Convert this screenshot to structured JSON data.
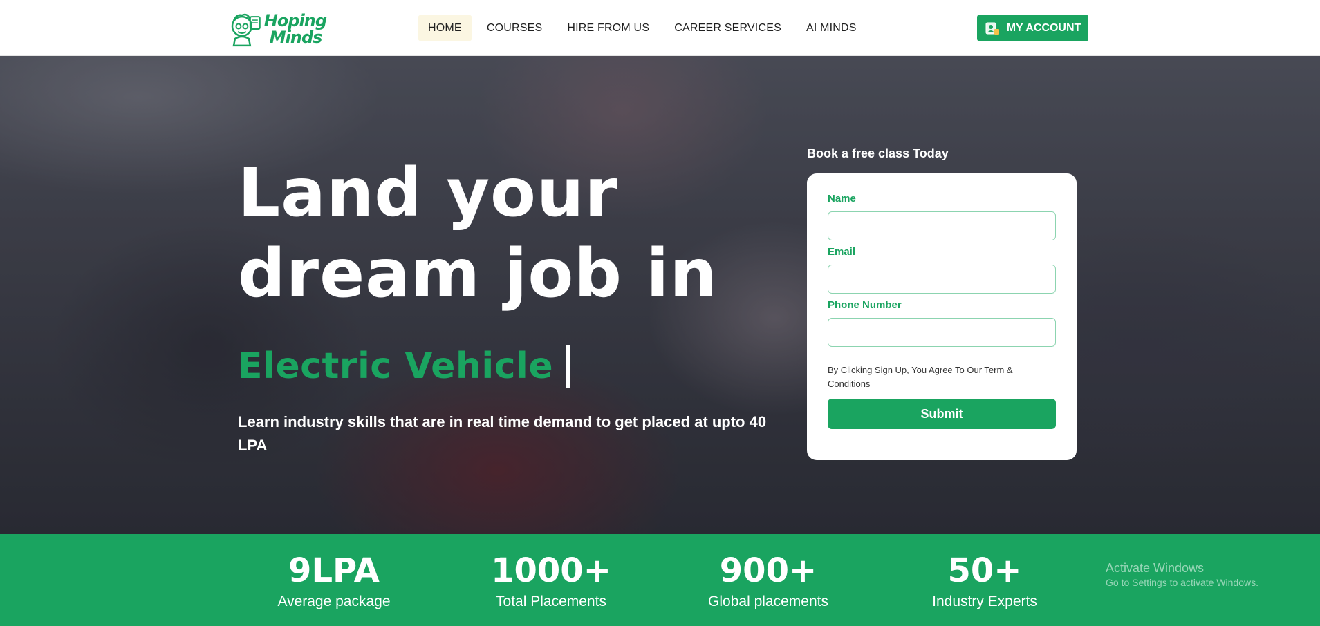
{
  "brand": {
    "line1": "Hoping",
    "line2": "Minds"
  },
  "nav": {
    "items": [
      {
        "label": "HOME",
        "active": true
      },
      {
        "label": "COURSES",
        "active": false
      },
      {
        "label": "HIRE FROM US",
        "active": false
      },
      {
        "label": "CAREER SERVICES",
        "active": false
      },
      {
        "label": "AI MINDS",
        "active": false
      }
    ],
    "account_label": "MY ACCOUNT"
  },
  "hero": {
    "headline_line1": "Land your",
    "headline_line2": "dream job in",
    "rotating_word": "Electric Vehicle",
    "subline": "Learn industry skills that are in real time demand to get placed at upto 40 LPA"
  },
  "form": {
    "title": "Book a free class Today",
    "name_label": "Name",
    "name_value": "",
    "email_label": "Email",
    "email_value": "",
    "phone_label": "Phone Number",
    "phone_value": "",
    "terms": "By Clicking Sign Up, You Agree To Our Term & Conditions",
    "submit_label": "Submit"
  },
  "stats": [
    {
      "value": "9LPA",
      "label": "Average package"
    },
    {
      "value": "1000+",
      "label": "Total Placements"
    },
    {
      "value": "900+",
      "label": "Global placements"
    },
    {
      "value": "50+",
      "label": "Industry Experts"
    }
  ],
  "watermark": {
    "line1": "Activate Windows",
    "line2": "Go to Settings to activate Windows."
  },
  "colors": {
    "brand_green": "#1aa460",
    "nav_active_bg": "#fbf6e2",
    "hero_overlay": "#3b3d47"
  }
}
